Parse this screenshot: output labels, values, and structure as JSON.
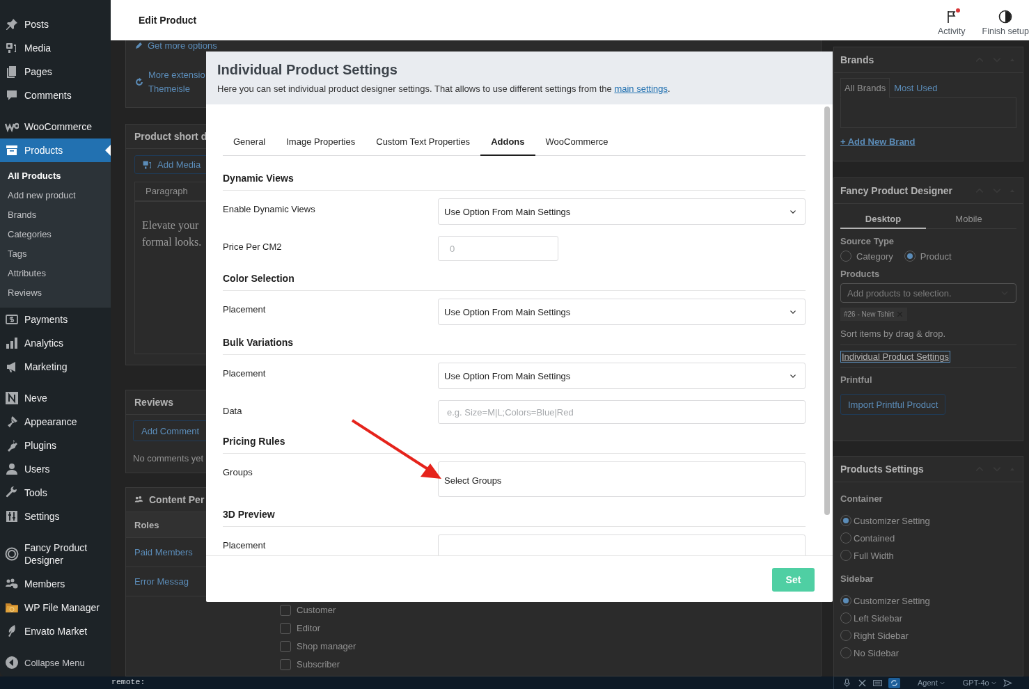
{
  "sidebar": {
    "groups": [
      {
        "items": [
          {
            "label": "Posts",
            "selected": false
          },
          {
            "label": "Media",
            "selected": false
          },
          {
            "label": "Pages",
            "selected": false
          },
          {
            "label": "Comments",
            "selected": false
          }
        ]
      },
      {
        "items": [
          {
            "label": "WooCommerce",
            "selected": false
          },
          {
            "label": "Products",
            "selected": true,
            "children": [
              {
                "label": "All Products",
                "selected": true
              },
              {
                "label": "Add new product",
                "selected": false
              },
              {
                "label": "Brands",
                "selected": false
              },
              {
                "label": "Categories",
                "selected": false
              },
              {
                "label": "Tags",
                "selected": false
              },
              {
                "label": "Attributes",
                "selected": false
              },
              {
                "label": "Reviews",
                "selected": false
              }
            ]
          },
          {
            "label": "Payments",
            "selected": false
          },
          {
            "label": "Analytics",
            "selected": false
          },
          {
            "label": "Marketing",
            "selected": false
          }
        ]
      },
      {
        "items": [
          {
            "label": "Neve",
            "selected": false
          },
          {
            "label": "Appearance",
            "selected": false
          },
          {
            "label": "Plugins",
            "selected": false
          },
          {
            "label": "Users",
            "selected": false
          },
          {
            "label": "Tools",
            "selected": false
          },
          {
            "label": "Settings",
            "selected": false
          }
        ]
      },
      {
        "items": [
          {
            "label": "Fancy Product Designer",
            "selected": false
          },
          {
            "label": "Members",
            "selected": false
          },
          {
            "label": "WP File Manager",
            "selected": false
          },
          {
            "label": "Envato Market",
            "selected": false
          }
        ]
      }
    ],
    "collapse": {
      "label": "Collapse Menu"
    }
  },
  "top_bar": {
    "title": "Edit Product",
    "actions": [
      {
        "label": "Activity",
        "notification": true
      },
      {
        "label": "Finish setup",
        "notification": false
      }
    ]
  },
  "background_page": {
    "extensions": {
      "get_more": "Get more options",
      "more_extensions": "More extensio",
      "themeisle": "Themeisle"
    },
    "short_description": {
      "title": "Product short d",
      "add_media": "Add Media",
      "block_format": "Paragraph",
      "content_lines": [
        "Elevate your",
        "formal looks."
      ]
    },
    "reviews": {
      "title": "Reviews",
      "add_comment": "Add Comment",
      "empty": "No comments yet"
    },
    "content_permissions": {
      "title": "Content Per",
      "tabs": [
        {
          "label": "Roles",
          "selected": true
        },
        {
          "label": "Paid Members",
          "selected": false
        },
        {
          "label": "Error Messag",
          "selected": false
        }
      ],
      "roles": [
        {
          "label": "Customer",
          "checked": false
        },
        {
          "label": "Editor",
          "checked": false
        },
        {
          "label": "Shop manager",
          "checked": false
        },
        {
          "label": "Subscriber",
          "checked": false
        }
      ]
    }
  },
  "right_column": {
    "brands": {
      "title": "Brands",
      "tabs": [
        {
          "label": "All Brands",
          "selected": true
        },
        {
          "label": "Most Used",
          "selected": false
        }
      ],
      "add_link": "+ Add New Brand"
    },
    "fpd": {
      "title": "Fancy Product Designer",
      "tabs": [
        {
          "label": "Desktop",
          "selected": true
        },
        {
          "label": "Mobile",
          "selected": false
        }
      ],
      "source_type_label": "Source Type",
      "source_types": [
        {
          "label": "Category",
          "selected": false
        },
        {
          "label": "Product",
          "selected": true
        }
      ],
      "products_label": "Products",
      "products_placeholder": "Add products to selection.",
      "selected_products": [
        "#26 - New Tshirt"
      ],
      "sort_hint": "Sort items by drag & drop.",
      "settings_link": "Individual Product Settings",
      "printful_label": "Printful",
      "printful_button": "Import Printful Product"
    },
    "products_settings": {
      "title": "Products Settings",
      "groups": [
        {
          "label": "Container",
          "options": [
            {
              "label": "Customizer Setting",
              "selected": true
            },
            {
              "label": "Contained",
              "selected": false
            },
            {
              "label": "Full Width",
              "selected": false
            }
          ]
        },
        {
          "label": "Sidebar",
          "options": [
            {
              "label": "Customizer Setting",
              "selected": true
            },
            {
              "label": "Left Sidebar",
              "selected": false
            },
            {
              "label": "Right Sidebar",
              "selected": false
            },
            {
              "label": "No Sidebar",
              "selected": false
            }
          ]
        }
      ]
    }
  },
  "terminal": {
    "text": "remote:",
    "tools": [
      {
        "label": "Agent"
      },
      {
        "label": "GPT-4o"
      }
    ]
  },
  "modal": {
    "title": "Individual Product Settings",
    "description": {
      "before": "Here you can set individual product designer settings. That allows to use different settings from the ",
      "link": "main settings",
      "after": "."
    },
    "tabs": [
      {
        "label": "General",
        "selected": false
      },
      {
        "label": "Image Properties",
        "selected": false
      },
      {
        "label": "Custom Text Properties",
        "selected": false
      },
      {
        "label": "Addons",
        "selected": true
      },
      {
        "label": "WooCommerce",
        "selected": false
      }
    ],
    "sections": [
      {
        "title": "Dynamic Views",
        "fields": [
          {
            "label": "Enable Dynamic Views",
            "kind": "select",
            "value": "Use Option From Main Settings"
          },
          {
            "label": "Price Per CM2",
            "kind": "number",
            "placeholder": "0"
          }
        ]
      },
      {
        "title": "Color Selection",
        "fields": [
          {
            "label": "Placement",
            "kind": "select",
            "value": "Use Option From Main Settings"
          }
        ]
      },
      {
        "title": "Bulk Variations",
        "fields": [
          {
            "label": "Placement",
            "kind": "select",
            "value": "Use Option From Main Settings"
          },
          {
            "label": "Data",
            "kind": "text",
            "placeholder": "e.g. Size=M|L;Colors=Blue|Red"
          }
        ]
      },
      {
        "title": "Pricing Rules",
        "fields": [
          {
            "label": "Groups",
            "kind": "multiselect",
            "placeholder": "Select Groups"
          }
        ]
      },
      {
        "title": "3D Preview",
        "fields": [
          {
            "label": "Placement",
            "kind": "select"
          }
        ]
      }
    ],
    "set_button": "Set"
  }
}
